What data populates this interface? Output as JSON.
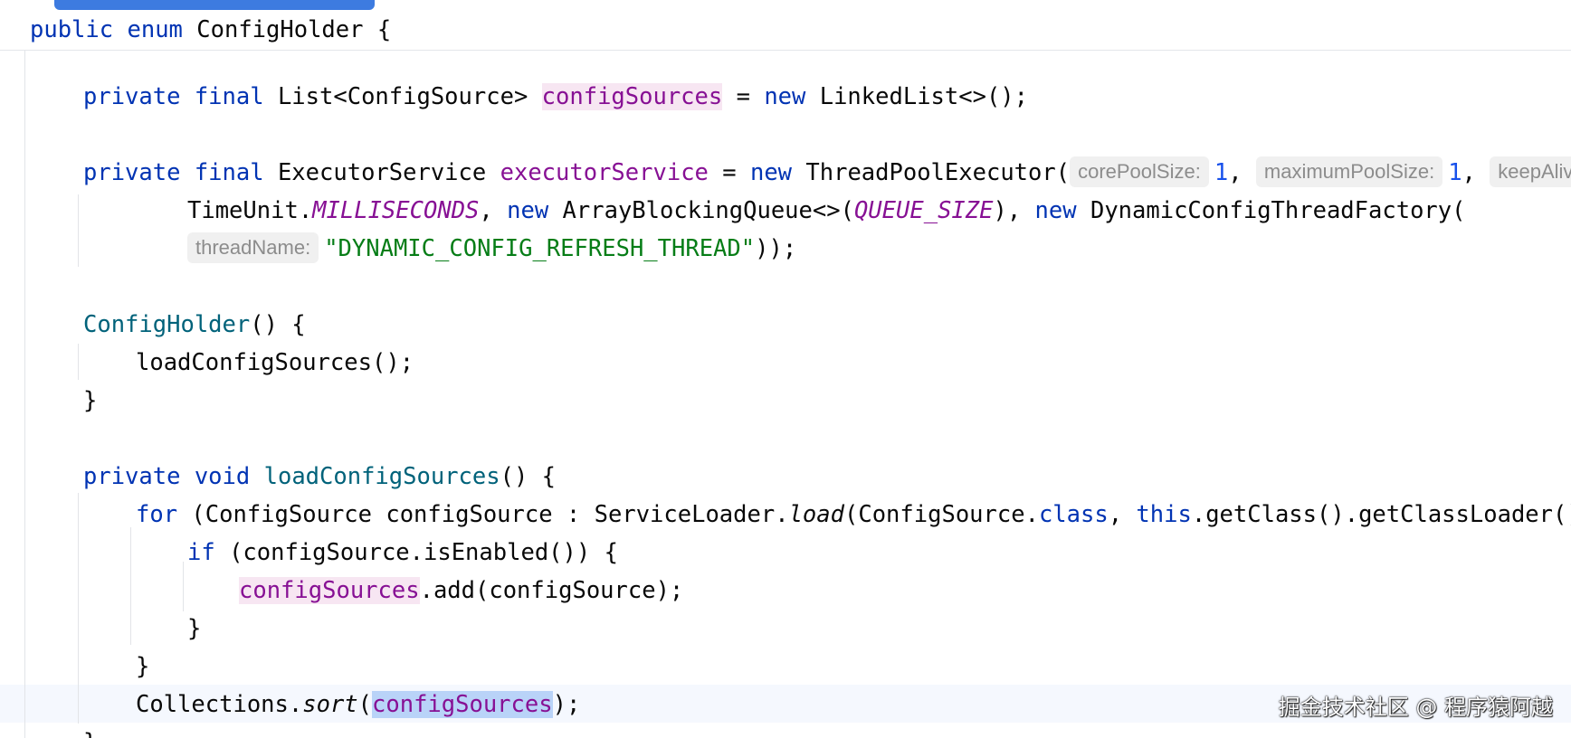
{
  "code": {
    "l1": {
      "kw1": "public",
      "kw2": "enum",
      "name": "ConfigHolder",
      "rest": " {"
    },
    "l2": {
      "kw1": "private",
      "kw2": "final",
      "type": "List<ConfigSource>",
      "field": "configSources",
      "eq": " = ",
      "kw3": "new",
      "rest": " LinkedList<>();"
    },
    "l3": {
      "kw1": "private",
      "kw2": "final",
      "type": "ExecutorService",
      "field": "executorService",
      "eq": " = ",
      "kw3": "new",
      "call": " ThreadPoolExecutor(",
      "hint1": "corePoolSize:",
      "v1": "1",
      "comma1": ", ",
      "hint2": "maximumPoolSize:",
      "v2": "1",
      "comma2": ", ",
      "hint3": "keepAliveTi"
    },
    "l4": {
      "t1": "TimeUnit.",
      "const1": "MILLISECONDS",
      "t2": ", ",
      "kw1": "new",
      "t3": " ArrayBlockingQueue<>(",
      "const2": "QUEUE_SIZE",
      "t4": "), ",
      "kw2": "new",
      "t5": " DynamicConfigThreadFactory("
    },
    "l5": {
      "hint": "threadName:",
      "str": "\"DYNAMIC_CONFIG_REFRESH_THREAD\"",
      "rest": "));"
    },
    "l6": {
      "ctor": "ConfigHolder",
      "rest": "() {"
    },
    "l7": {
      "text": "loadConfigSources();"
    },
    "l8": {
      "text": "}"
    },
    "l9": {
      "kw1": "private",
      "kw2": "void",
      "method": "loadConfigSources",
      "rest": "() {"
    },
    "l10": {
      "kw1": "for",
      "t1": " (ConfigSource configSource : ServiceLoader.",
      "m": "load",
      "t2": "(ConfigSource.",
      "kw2": "class",
      "t3": ", ",
      "kw3": "this",
      "t4": ".getClass().getClassLoader())) {"
    },
    "l11": {
      "kw": "if",
      "rest": " (configSource.isEnabled()) {"
    },
    "l12": {
      "field": "configSources",
      "rest": ".add(configSource);"
    },
    "l13": {
      "text": "}"
    },
    "l14": {
      "text": "}"
    },
    "l15": {
      "t1": "Collections.",
      "m": "sort",
      "t2": "(",
      "field": "configSources",
      "t3": ");"
    },
    "l16": {
      "text": "}"
    }
  },
  "watermark": "掘金技术社区 @ 程序猿阿越",
  "colors": {
    "keyword": "#0033b3",
    "field": "#871094",
    "method": "#00627a",
    "string": "#067d17",
    "number": "#1750eb",
    "selection": "#b9d3f8",
    "usage_highlight": "#f7e6f2",
    "scroll_indicator": "#3d7be0"
  }
}
